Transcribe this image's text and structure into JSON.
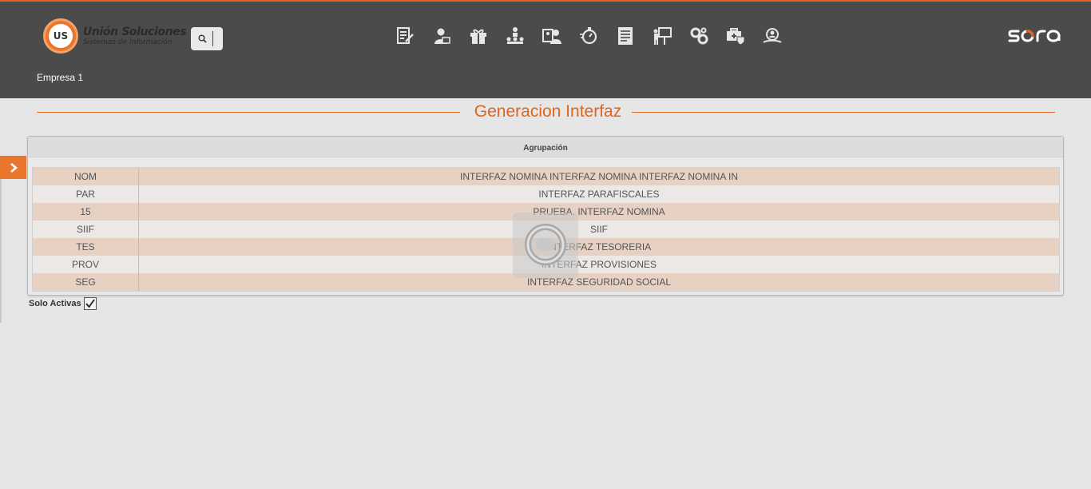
{
  "header": {
    "logo": {
      "title": "Unión Soluciones",
      "subtitle": "Sistemas de Información",
      "badge": "US"
    },
    "search": {
      "icon": "search-icon"
    },
    "nav_icons": [
      "document-edit-icon",
      "user-profile-icon",
      "gift-icon",
      "organization-hierarchy-icon",
      "employee-card-icon",
      "stopwatch-icon",
      "report-document-icon",
      "presentation-icon",
      "settings-gears-icon",
      "medical-case-icon",
      "user-search-icon"
    ],
    "brand": "sora",
    "company": "Empresa 1"
  },
  "page": {
    "title": "Generacion Interfaz"
  },
  "panel": {
    "header": "Agrupación",
    "rows": [
      {
        "code": "NOM",
        "description": "INTERFAZ NOMINA INTERFAZ NOMINA INTERFAZ NOMINA IN"
      },
      {
        "code": "PAR",
        "description": "INTERFAZ PARAFISCALES"
      },
      {
        "code": "15",
        "description": "PRUEBA. INTERFAZ NOMINA"
      },
      {
        "code": "SIIF",
        "description": "SIIF"
      },
      {
        "code": "TES",
        "description": "INTERFAZ TESORERIA"
      },
      {
        "code": "PROV",
        "description": "INTERFAZ PROVISIONES"
      },
      {
        "code": "SEG",
        "description": "INTERFAZ SEGURIDAD SOCIAL"
      }
    ]
  },
  "filter": {
    "label": "Solo Activas",
    "checked": true
  },
  "colors": {
    "accent": "#e0651c",
    "header_bg": "#4b4b4b",
    "row_highlight": "#e6d1c3"
  }
}
